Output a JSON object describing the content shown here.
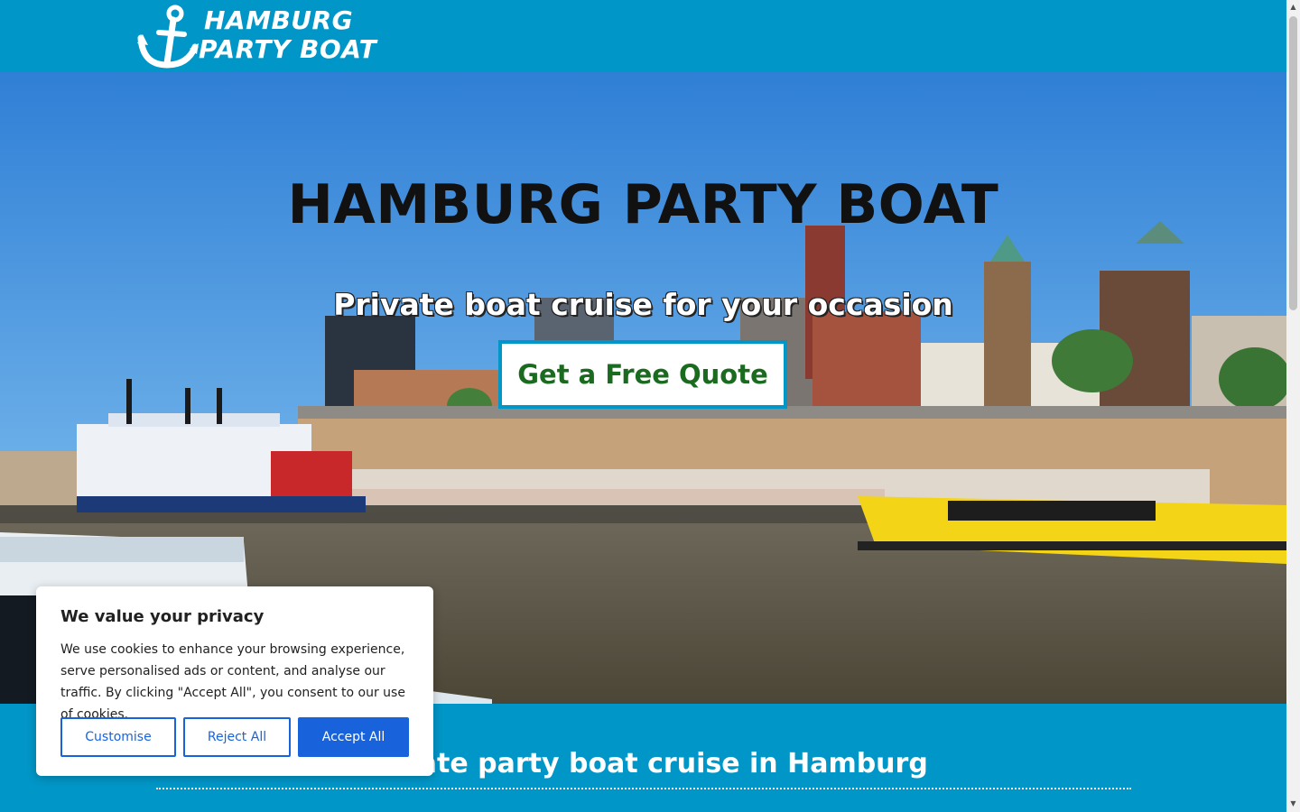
{
  "header": {
    "logo_line1": "HAMBURG",
    "logo_line2": "PARTY BOAT",
    "logo_icon": "anchor-icon",
    "background_color": "#0096c7"
  },
  "hero": {
    "title": "HAMBURG PARTY BOAT",
    "subtitle": "Private boat cruise for your occasion",
    "cta_label": "Get a Free Quote",
    "cta_text_color": "#1a6b1f"
  },
  "section": {
    "heading": "Private party boat cruise in Hamburg"
  },
  "cookie_banner": {
    "title": "We value your privacy",
    "text": "We use cookies to enhance your browsing experience, serve personalised ads or content, and analyse our traffic. By clicking \"Accept All\", you consent to our use of cookies.",
    "customise_label": "Customise",
    "reject_label": "Reject All",
    "accept_label": "Accept All",
    "accent_color": "#1863dc"
  }
}
